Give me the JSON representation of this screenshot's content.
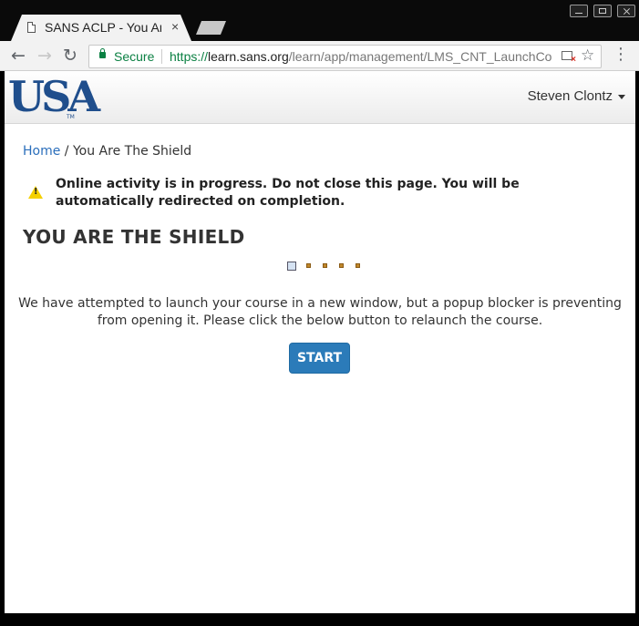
{
  "browser": {
    "tab_title": "SANS ACLP - You Are The Shield",
    "tab_close": "×",
    "back_icon": "back-arrow-icon",
    "forward_icon": "forward-arrow-icon",
    "reload_icon": "reload-icon",
    "secure_label": "Secure",
    "url_scheme": "https://",
    "url_host": "learn.sans.org",
    "url_path": "/learn/app/management/LMS_CNT_LaunchCourse",
    "menu_icon": "⋮"
  },
  "header": {
    "logo_text": "USA",
    "logo_tm": "TM",
    "user_name": "Steven Clontz"
  },
  "breadcrumb": {
    "home": "Home",
    "separator": " / ",
    "current": "You Are The Shield"
  },
  "alert": {
    "text": "Online activity is in progress. Do not close this page. You will be automatically redirected on completion."
  },
  "main": {
    "title": "YOU ARE THE SHIELD",
    "message": "We have attempted to launch your course in a new window, but a popup blocker is preventing from opening it. Please click the below button to relaunch the course.",
    "start_label": "START"
  },
  "colors": {
    "link": "#2a6ebb",
    "button": "#2b7bb9",
    "secure": "#0b8043",
    "warning": "#f5d000"
  }
}
